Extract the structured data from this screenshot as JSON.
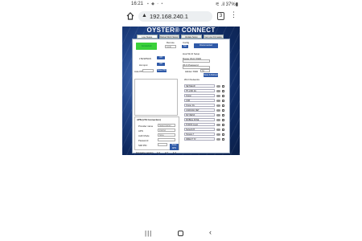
{
  "status_bar": {
    "time": "16:21",
    "indicators": "▪ ◆ ◦ •",
    "right": "⚟ .il 37%▮"
  },
  "browser": {
    "url": "192.168.240.1",
    "tab_count": "3",
    "menu": "⋮"
  },
  "page": {
    "brand": "OYSTER® CONNECT",
    "nav_tabs": [
      "Live Status",
      "Debug Wi-Fi Setup",
      "Update Setup",
      "Get your Firmware"
    ],
    "top_left": {
      "status_label": "Connected",
      "mode_label": "Remote",
      "mode_value": "Local"
    },
    "top_right": {
      "config_label": "Config",
      "config_btn": "Set",
      "btn": "Disconnected"
    },
    "left_section": {
      "label1": "LTE/WWAN",
      "btn1": "Off",
      "label2": "Hot spot",
      "btn2": "Off",
      "label3": "Auto PIN",
      "btn3": "Save PIN"
    },
    "right_section": {
      "title": "Host Wi-Fi Setup",
      "ssid_label": "Router Wi-Fi SSID",
      "pwd_label": "Wi-Fi Password",
      "hidden_label": "Hidden SSID",
      "hidden_value": "No",
      "btn": "Save & Reboot"
    },
    "networks": {
      "title": "Wi-Fi Networks",
      "items": [
        "NETGEAR",
        "TP-LINK 2G",
        "Oyster",
        "CAB",
        "Oyster 4G",
        "CARAVAN NET",
        "SKYDESK",
        "MOBILE ZONE",
        "TFWIFI Guest",
        "Network B",
        "Hotspot 7",
        "DIRECT TV"
      ]
    },
    "apn": {
      "title": "APN (LTE Connection)",
      "fields": [
        {
          "label": "Provider name",
          "value": "Select Carrier"
        },
        {
          "label": "APN",
          "value": "internet"
        },
        {
          "label": "Auth Mode",
          "value": "None"
        },
        {
          "label": "Password",
          "value": ""
        },
        {
          "label": "SIM PIN",
          "value": ""
        }
      ],
      "btn": "Save APN"
    },
    "footer": {
      "label": "Firmware version",
      "v1": "1.0",
      "v2": "2.7",
      "v3": "1.2"
    }
  }
}
